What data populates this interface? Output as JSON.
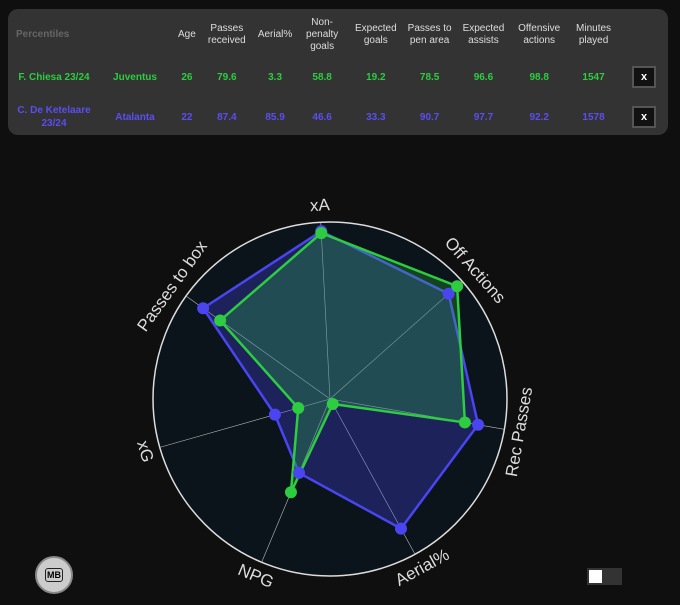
{
  "table": {
    "corner": "Percentiles",
    "headers": [
      "Age",
      "Passes received",
      "Aerial%",
      "Non-penalty goals",
      "Expected goals",
      "Passes to pen area",
      "Expected assists",
      "Offensive actions",
      "Minutes played"
    ],
    "rows": [
      {
        "player": "F. Chiesa 23/24",
        "team": "Juventus",
        "color": "#2ecc40",
        "values": [
          "26",
          "79.6",
          "3.3",
          "58.8",
          "19.2",
          "78.5",
          "96.6",
          "98.8",
          "1547"
        ],
        "remove": "x"
      },
      {
        "player": "C. De Ketelaare 23/24",
        "team": "Atalanta",
        "color": "#5b4ef0",
        "values": [
          "22",
          "87.4",
          "85.9",
          "46.6",
          "33.3",
          "90.7",
          "97.7",
          "92.2",
          "1578"
        ],
        "remove": "x"
      }
    ]
  },
  "chart_data": {
    "type": "radar",
    "axes": [
      "xA",
      "Off Actions",
      "Rec Passes",
      "Aerial%",
      "NPG",
      "xG",
      "Passes to box"
    ],
    "range": [
      0,
      100
    ],
    "series": [
      {
        "name": "F. Chiesa 23/24",
        "color": "#2ecc40",
        "values": [
          96.6,
          98.8,
          79.6,
          3.3,
          58.8,
          19.2,
          78.5
        ]
      },
      {
        "name": "C. De Ketelaare 23/24",
        "color": "#4a45f0",
        "values": [
          97.7,
          92.2,
          87.4,
          85.9,
          46.6,
          33.3,
          90.7
        ]
      }
    ]
  },
  "logo": "MB"
}
